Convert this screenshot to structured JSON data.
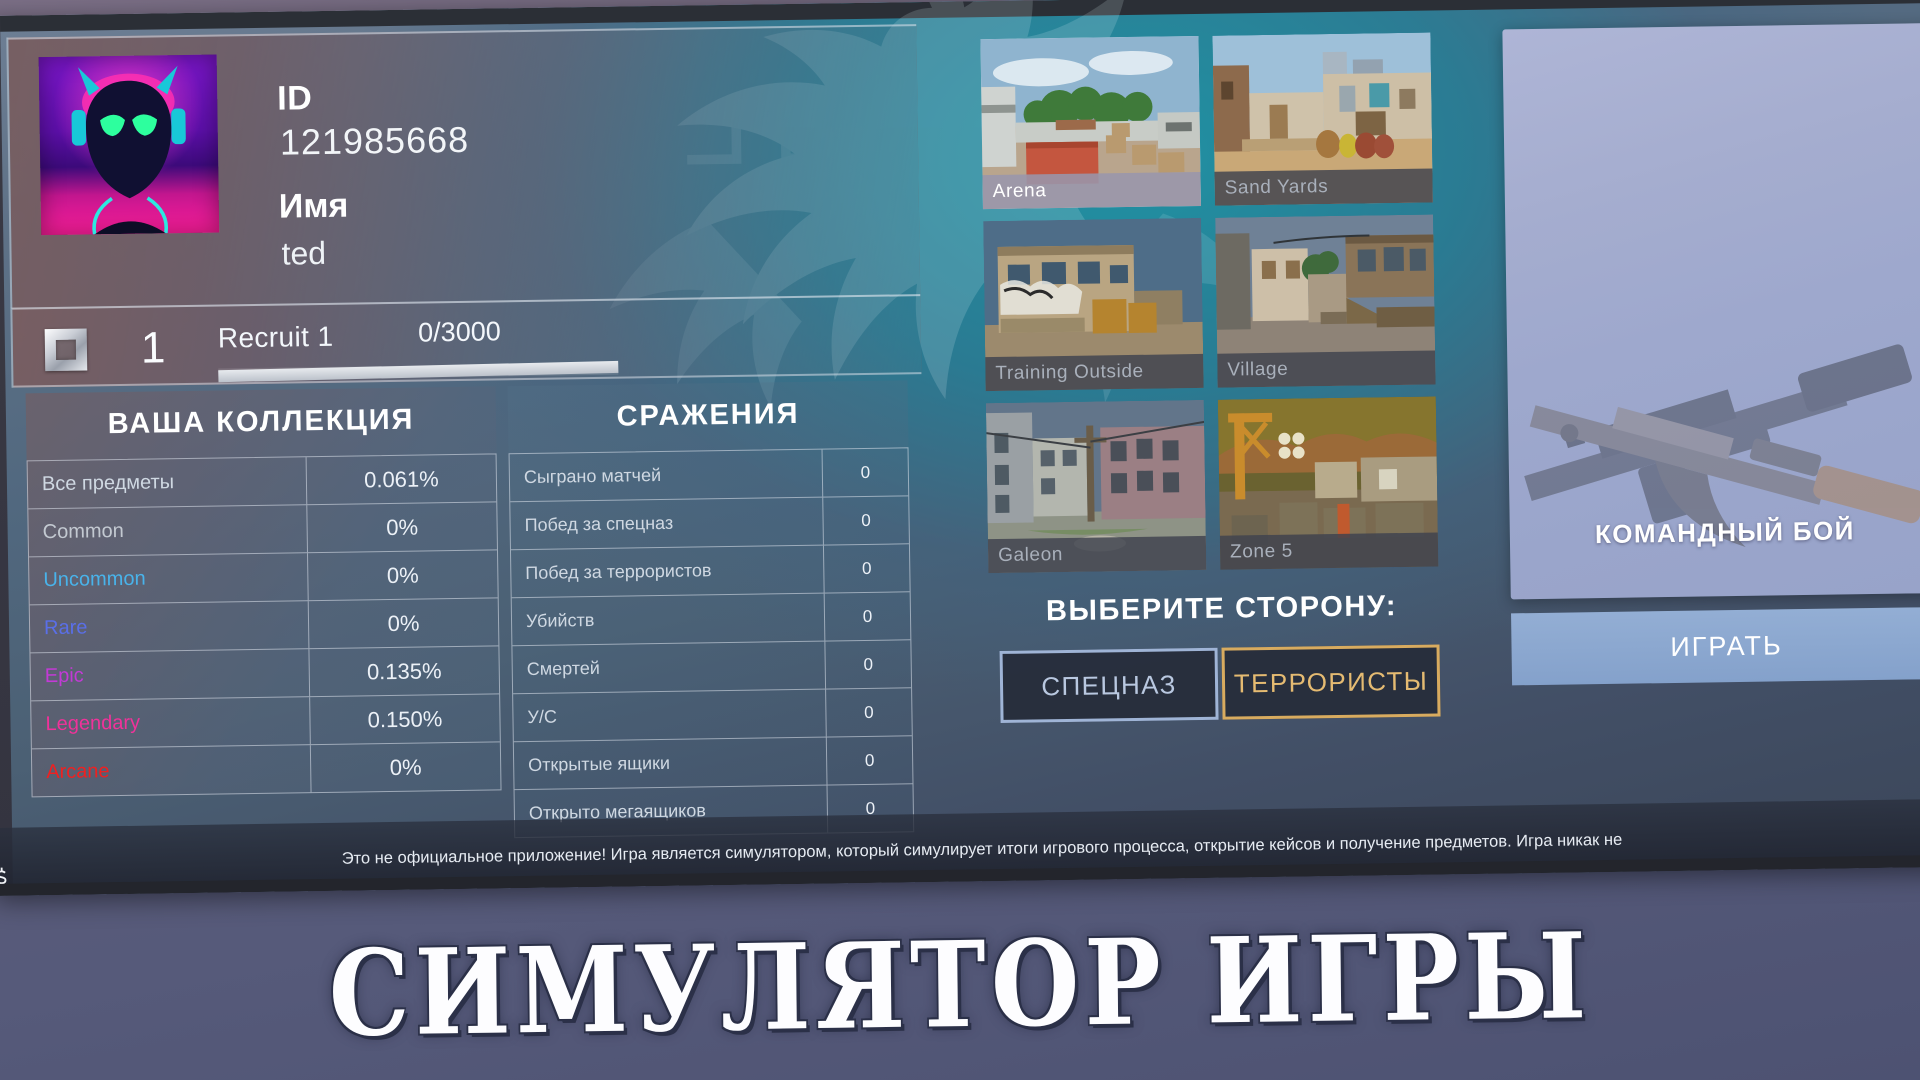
{
  "app": {
    "big_title": "СИМУЛЯТОР ИГРЫ",
    "disclaimer": "Это не официальное приложение! Игра является симулятором, который симулирует итоги игрового процесса, открытие кейсов и получение предметов. Игра никак не"
  },
  "profile": {
    "id_label": "ID",
    "id_value": "121985668",
    "name_label": "Имя",
    "name_value": "ted",
    "avatar_icon": "cyber-demon-avatar"
  },
  "rank": {
    "level": "1",
    "title": "Recruit 1",
    "xp": "0/3000",
    "progress_percent": 0,
    "badge_icon": "rank-square-icon"
  },
  "collection": {
    "title": "ВАША КОЛЛЕКЦИЯ",
    "rows": [
      {
        "label": "Все предметы",
        "value": "0.061%",
        "class": ""
      },
      {
        "label": "Common",
        "value": "0%",
        "class": "r-common"
      },
      {
        "label": "Uncommon",
        "value": "0%",
        "class": "r-uncommon"
      },
      {
        "label": "Rare",
        "value": "0%",
        "class": "r-rare"
      },
      {
        "label": "Epic",
        "value": "0.135%",
        "class": "r-epic"
      },
      {
        "label": "Legendary",
        "value": "0.150%",
        "class": "r-legendary"
      },
      {
        "label": "Arcane",
        "value": "0%",
        "class": "r-arcane"
      }
    ],
    "colors": {
      "common": "#c3c9d1",
      "uncommon": "#49b3ea",
      "rare": "#5a6fe8",
      "epic": "#c33ad6",
      "legendary": "#f0329a",
      "arcane": "#f02020"
    }
  },
  "battles": {
    "title": "СРАЖЕНИЯ",
    "rows": [
      {
        "label": "Сыграно матчей",
        "value": "0"
      },
      {
        "label": "Побед за спецназ",
        "value": "0"
      },
      {
        "label": "Побед за террористов",
        "value": "0"
      },
      {
        "label": "Убийств",
        "value": "0"
      },
      {
        "label": "Смертей",
        "value": "0"
      },
      {
        "label": "У/С",
        "value": "0"
      },
      {
        "label": "Открытые ящики",
        "value": "0"
      },
      {
        "label": "Открыто мегаящиков",
        "value": "0"
      }
    ]
  },
  "maps": [
    {
      "name": "Arena",
      "selected": true,
      "scene": "arena"
    },
    {
      "name": "Sand Yards",
      "selected": false,
      "scene": "sand"
    },
    {
      "name": "Training Outside",
      "selected": false,
      "scene": "training"
    },
    {
      "name": "Village",
      "selected": false,
      "scene": "village"
    },
    {
      "name": "Galeon",
      "selected": false,
      "scene": "galeon"
    },
    {
      "name": "Zone 5",
      "selected": false,
      "scene": "zone5"
    }
  ],
  "side_select": {
    "title": "ВЫБЕРИТЕ СТОРОНУ:",
    "ct_label": "СПЕЦНАЗ",
    "t_label": "ТЕРРОРИСТЫ",
    "ct_color": "#9fb4d6",
    "t_color": "#d8ab5f"
  },
  "mode": {
    "label": "КОМАНДНЫЙ БОЙ",
    "play_label": "ИГРАТЬ",
    "play_color": "#8ca9d0",
    "icon": "crossed-rifles-icon"
  }
}
